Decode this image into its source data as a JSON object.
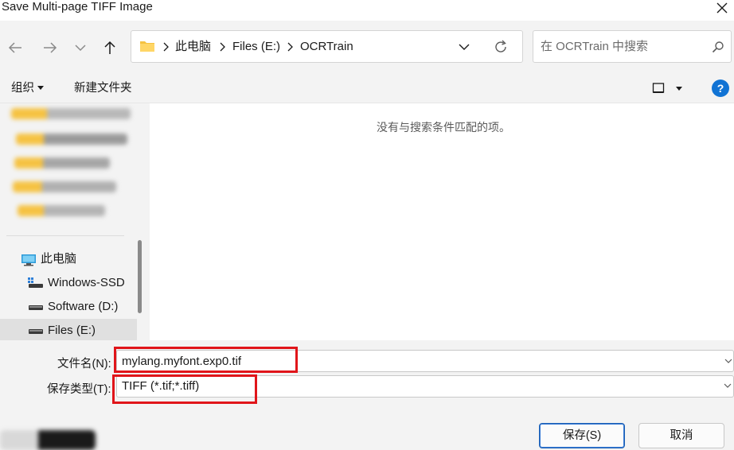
{
  "window": {
    "title": "Save Multi-page TIFF Image",
    "close_glyph": "✕"
  },
  "navigation": {
    "back_icon": "arrow-left-icon",
    "forward_icon": "arrow-right-icon",
    "recent_icon": "chevron-down-icon",
    "up_icon": "arrow-up-icon"
  },
  "address": {
    "breadcrumbs": [
      "此电脑",
      "Files (E:)",
      "OCRTrain"
    ],
    "refresh_icon": "refresh-icon"
  },
  "search": {
    "placeholder": "在 OCRTrain 中搜索"
  },
  "toolbar": {
    "organize_label": "组织",
    "new_folder_label": "新建文件夹",
    "view_icon": "view-layout-icon",
    "help_glyph": "?"
  },
  "nav_pane": {
    "items": [
      {
        "label": "此电脑",
        "icon": "computer-icon"
      },
      {
        "label": "Windows-SSD",
        "icon": "system-drive-icon"
      },
      {
        "label": "Software (D:)",
        "icon": "drive-icon"
      },
      {
        "label": "Files (E:)",
        "icon": "drive-icon",
        "selected": true
      }
    ]
  },
  "content": {
    "empty_message": "没有与搜索条件匹配的项。"
  },
  "form": {
    "filename_label": "文件名(N):",
    "filename_value": "mylang.myfont.exp0.tif",
    "filetype_label": "保存类型(T):",
    "filetype_value": "TIFF (*.tif;*.tiff)",
    "save_label": "保存(S)",
    "cancel_label": "取消"
  },
  "colors": {
    "accent": "#1173d4",
    "highlight_box": "#e0151a",
    "folder_yellow": "#f5c242"
  }
}
